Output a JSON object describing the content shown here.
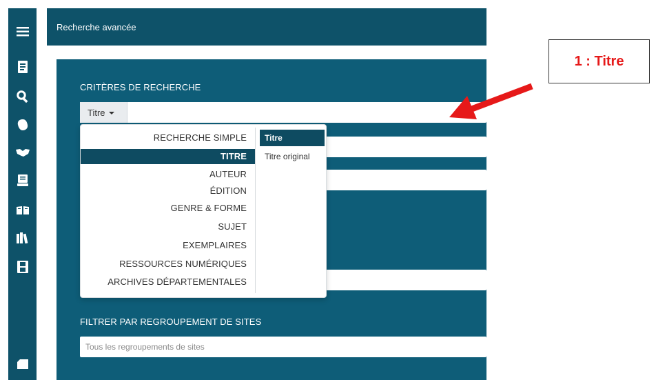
{
  "topbar": {
    "title": "Recherche avancée"
  },
  "sidebar": {
    "icons": [
      "menu-icon",
      "document-icon",
      "search-icon",
      "user-icon",
      "handshake-icon",
      "inbox-icon",
      "open-book-icon",
      "library-icon",
      "film-icon",
      "tag-icon"
    ]
  },
  "criteria": {
    "label": "CRITÈRES DE RECHERCHE",
    "select_label": "Titre"
  },
  "dropdown": {
    "categories": [
      {
        "label": "RECHERCHE SIMPLE",
        "active": false
      },
      {
        "label": "TITRE",
        "active": true
      },
      {
        "label": "AUTEUR",
        "active": false
      },
      {
        "label": "ÉDITION",
        "active": false
      },
      {
        "label": "GENRE & FORME",
        "active": false
      },
      {
        "label": "SUJET",
        "active": false
      },
      {
        "label": "EXEMPLAIRES",
        "active": false
      },
      {
        "label": "RESSOURCES NUMÉRIQUES",
        "active": false
      },
      {
        "label": "ARCHIVES DÉPARTEMENTALES",
        "active": false
      }
    ],
    "subitems": [
      {
        "label": "Titre",
        "active": true
      },
      {
        "label": "Titre original",
        "active": false
      }
    ]
  },
  "filter": {
    "label": "FILTRER PAR REGROUPEMENT DE SITES",
    "placeholder": "Tous les regroupements de sites"
  },
  "annotation": {
    "callout": "1 : Titre",
    "color": "#e61919"
  },
  "colors": {
    "primary": "#0e5269",
    "panel": "#0e5d78",
    "active": "#0e4b61"
  }
}
